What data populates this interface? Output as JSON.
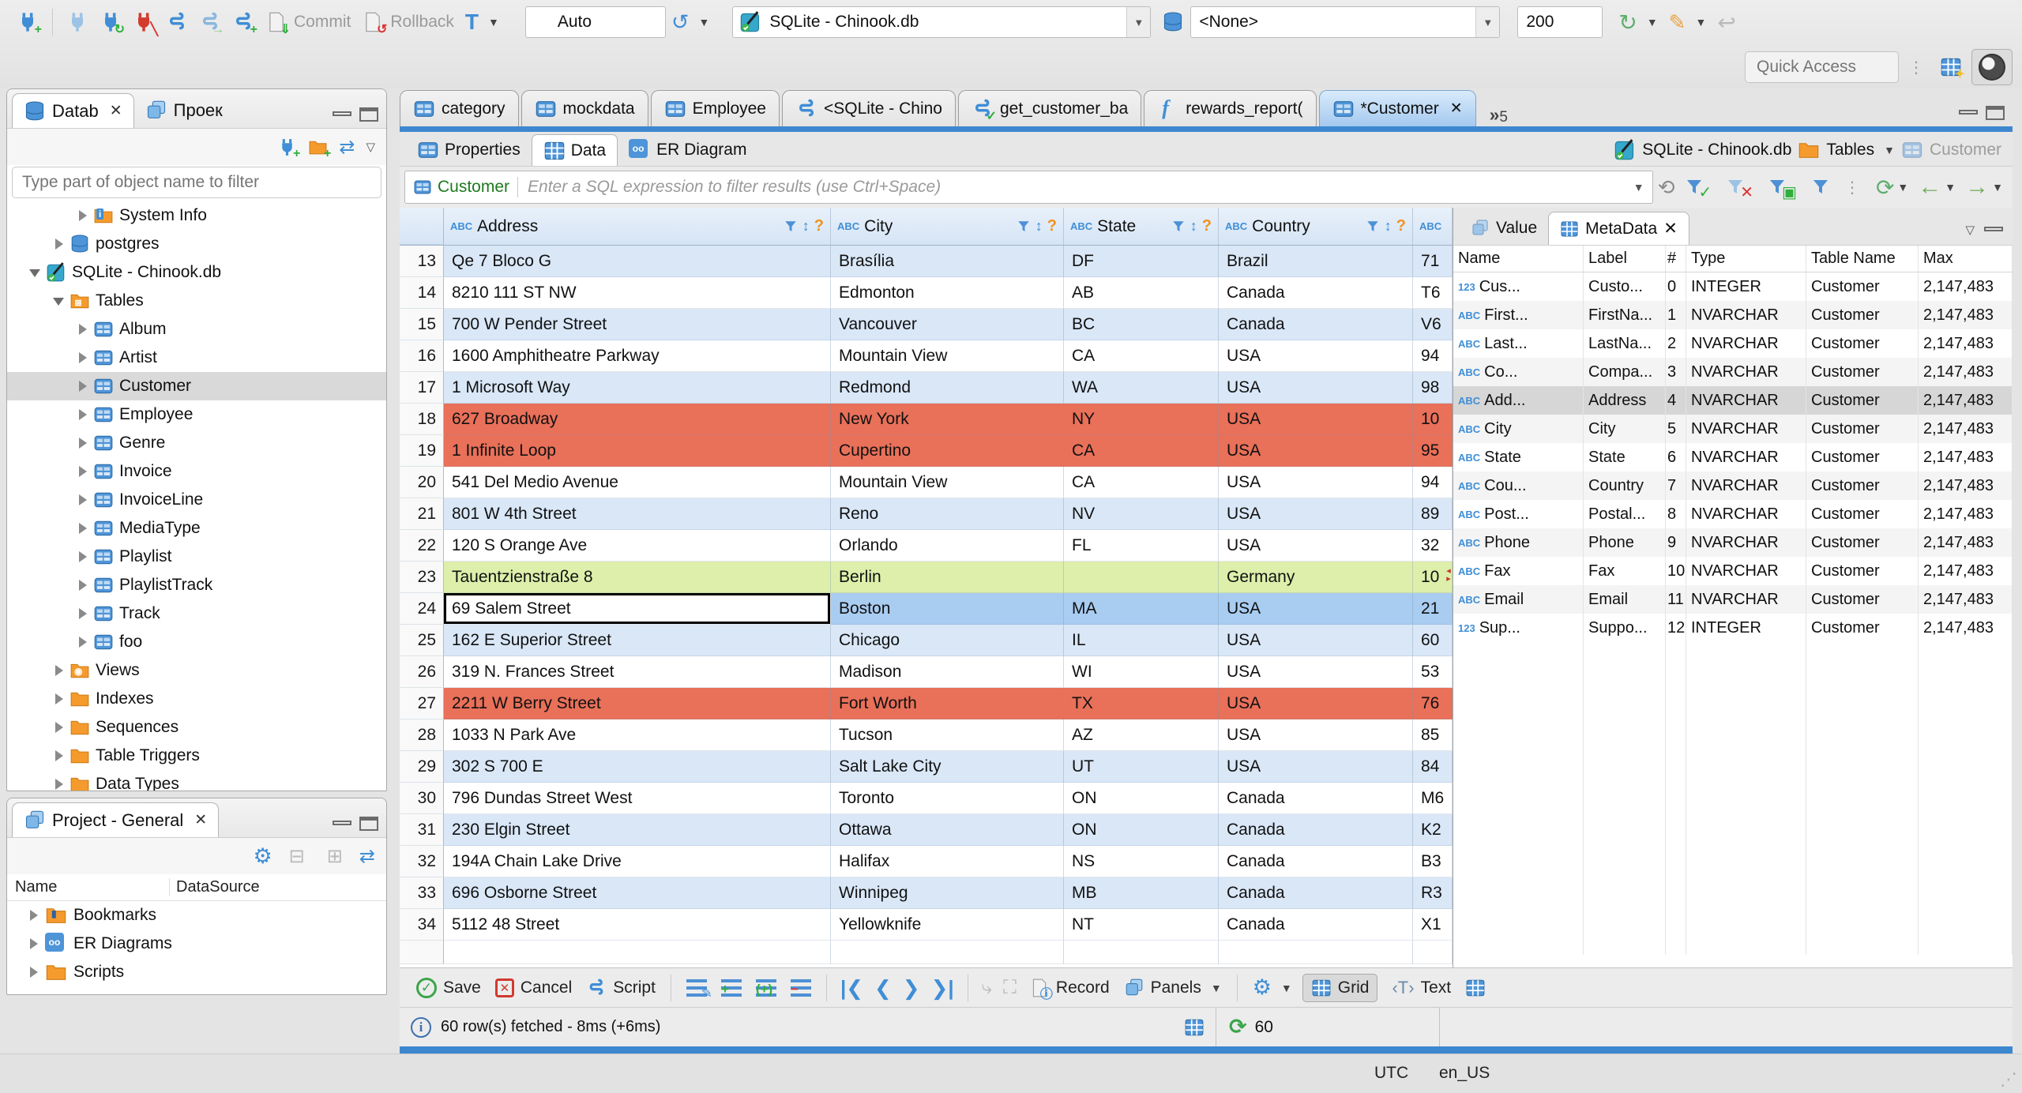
{
  "topbar": {
    "commit": "Commit",
    "rollback": "Rollback",
    "auto": "Auto",
    "connection": "SQLite - Chinook.db",
    "schema": "<None>",
    "fetch_size": "200",
    "quick_access": "Quick Access"
  },
  "nav_panel": {
    "tab_database": "Datab",
    "tab_projects": "Проек",
    "filter_placeholder": "Type part of object name to filter",
    "tree": [
      {
        "label": "System Info",
        "icon": "folder-info",
        "indent": 2,
        "arrow": "collapsed"
      },
      {
        "label": "postgres",
        "icon": "db",
        "indent": 1,
        "arrow": "collapsed"
      },
      {
        "label": "SQLite - Chinook.db",
        "icon": "sqlite",
        "indent": 0,
        "arrow": "expanded"
      },
      {
        "label": "Tables",
        "icon": "folder-table",
        "indent": 1,
        "arrow": "expanded"
      },
      {
        "label": "Album",
        "icon": "table",
        "indent": 2,
        "arrow": "collapsed"
      },
      {
        "label": "Artist",
        "icon": "table",
        "indent": 2,
        "arrow": "collapsed"
      },
      {
        "label": "Customer",
        "icon": "table",
        "indent": 2,
        "arrow": "collapsed",
        "selected": true
      },
      {
        "label": "Employee",
        "icon": "table",
        "indent": 2,
        "arrow": "collapsed"
      },
      {
        "label": "Genre",
        "icon": "table",
        "indent": 2,
        "arrow": "collapsed"
      },
      {
        "label": "Invoice",
        "icon": "table",
        "indent": 2,
        "arrow": "collapsed"
      },
      {
        "label": "InvoiceLine",
        "icon": "table",
        "indent": 2,
        "arrow": "collapsed"
      },
      {
        "label": "MediaType",
        "icon": "table",
        "indent": 2,
        "arrow": "collapsed"
      },
      {
        "label": "Playlist",
        "icon": "table",
        "indent": 2,
        "arrow": "collapsed"
      },
      {
        "label": "PlaylistTrack",
        "icon": "table",
        "indent": 2,
        "arrow": "collapsed"
      },
      {
        "label": "Track",
        "icon": "table",
        "indent": 2,
        "arrow": "collapsed"
      },
      {
        "label": "foo",
        "icon": "table",
        "indent": 2,
        "arrow": "collapsed"
      },
      {
        "label": "Views",
        "icon": "folder-eye",
        "indent": 1,
        "arrow": "collapsed"
      },
      {
        "label": "Indexes",
        "icon": "folder",
        "indent": 1,
        "arrow": "collapsed"
      },
      {
        "label": "Sequences",
        "icon": "folder",
        "indent": 1,
        "arrow": "collapsed"
      },
      {
        "label": "Table Triggers",
        "icon": "folder",
        "indent": 1,
        "arrow": "collapsed"
      },
      {
        "label": "Data Types",
        "icon": "folder",
        "indent": 1,
        "arrow": "collapsed"
      }
    ]
  },
  "project_panel": {
    "title": "Project - General",
    "columns": [
      "Name",
      "DataSource"
    ],
    "items": [
      {
        "label": "Bookmarks",
        "icon": "folder-bookmark"
      },
      {
        "label": "ER Diagrams",
        "icon": "er"
      },
      {
        "label": "Scripts",
        "icon": "folder"
      }
    ]
  },
  "editor": {
    "tabs": [
      {
        "label": "category",
        "icon": "table"
      },
      {
        "label": "mockdata",
        "icon": "table"
      },
      {
        "label": "Employee",
        "icon": "table"
      },
      {
        "label": "<SQLite - Chino",
        "icon": "script"
      },
      {
        "label": "get_customer_ba",
        "icon": "script-check"
      },
      {
        "label": "rewards_report(",
        "icon": "func"
      },
      {
        "label": "*Customer",
        "icon": "table",
        "active": true,
        "closable": true
      }
    ],
    "overflow_count": "5",
    "inner_tabs": [
      {
        "label": "Properties",
        "icon": "table"
      },
      {
        "label": "Data",
        "icon": "grid",
        "active": true
      },
      {
        "label": "ER Diagram",
        "icon": "er"
      }
    ],
    "breadcrumb": {
      "connection": "SQLite - Chinook.db",
      "container": "Tables",
      "entity": "Customer"
    }
  },
  "filter_bar": {
    "table": "Customer",
    "placeholder": "Enter a SQL expression to filter results (use Ctrl+Space)"
  },
  "grid": {
    "columns": [
      "Address",
      "City",
      "State",
      "Country"
    ],
    "partial_column": "ABC",
    "rows": [
      {
        "num": "13",
        "address": "Qe 7 Bloco G",
        "city": "Brasília",
        "state": "DF",
        "country": "Brazil",
        "postal": "71",
        "style": "tint"
      },
      {
        "num": "14",
        "address": "8210 111 ST NW",
        "city": "Edmonton",
        "state": "AB",
        "country": "Canada",
        "postal": "T6",
        "style": "plain"
      },
      {
        "num": "15",
        "address": "700 W Pender Street",
        "city": "Vancouver",
        "state": "BC",
        "country": "Canada",
        "postal": "V6",
        "style": "tint"
      },
      {
        "num": "16",
        "address": "1600 Amphitheatre Parkway",
        "city": "Mountain View",
        "state": "CA",
        "country": "USA",
        "postal": "94",
        "style": "plain"
      },
      {
        "num": "17",
        "address": "1 Microsoft Way",
        "city": "Redmond",
        "state": "WA",
        "country": "USA",
        "postal": "98",
        "style": "tint"
      },
      {
        "num": "18",
        "address": "627 Broadway",
        "city": "New York",
        "state": "NY",
        "country": "USA",
        "postal": "10",
        "style": "red"
      },
      {
        "num": "19",
        "address": "1 Infinite Loop",
        "city": "Cupertino",
        "state": "CA",
        "country": "USA",
        "postal": "95",
        "style": "red"
      },
      {
        "num": "20",
        "address": "541 Del Medio Avenue",
        "city": "Mountain View",
        "state": "CA",
        "country": "USA",
        "postal": "94",
        "style": "plain"
      },
      {
        "num": "21",
        "address": "801 W 4th Street",
        "city": "Reno",
        "state": "NV",
        "country": "USA",
        "postal": "89",
        "style": "tint"
      },
      {
        "num": "22",
        "address": "120 S Orange Ave",
        "city": "Orlando",
        "state": "FL",
        "country": "USA",
        "postal": "32",
        "style": "plain"
      },
      {
        "num": "23",
        "address": "Tauentzienstraße 8",
        "city": "Berlin",
        "state": "",
        "country": "Germany",
        "postal": "10",
        "style": "green"
      },
      {
        "num": "24",
        "address": "69 Salem Street",
        "city": "Boston",
        "state": "MA",
        "country": "USA",
        "postal": "21",
        "style": "selected"
      },
      {
        "num": "25",
        "address": "162 E Superior Street",
        "city": "Chicago",
        "state": "IL",
        "country": "USA",
        "postal": "60",
        "style": "tint"
      },
      {
        "num": "26",
        "address": "319 N. Frances Street",
        "city": "Madison",
        "state": "WI",
        "country": "USA",
        "postal": "53",
        "style": "plain"
      },
      {
        "num": "27",
        "address": "2211 W Berry Street",
        "city": "Fort Worth",
        "state": "TX",
        "country": "USA",
        "postal": "76",
        "style": "red"
      },
      {
        "num": "28",
        "address": "1033 N Park Ave",
        "city": "Tucson",
        "state": "AZ",
        "country": "USA",
        "postal": "85",
        "style": "plain"
      },
      {
        "num": "29",
        "address": "302 S 700 E",
        "city": "Salt Lake City",
        "state": "UT",
        "country": "USA",
        "postal": "84",
        "style": "tint"
      },
      {
        "num": "30",
        "address": "796 Dundas Street West",
        "city": "Toronto",
        "state": "ON",
        "country": "Canada",
        "postal": "M6",
        "style": "plain"
      },
      {
        "num": "31",
        "address": "230 Elgin Street",
        "city": "Ottawa",
        "state": "ON",
        "country": "Canada",
        "postal": "K2",
        "style": "tint"
      },
      {
        "num": "32",
        "address": "194A Chain Lake Drive",
        "city": "Halifax",
        "state": "NS",
        "country": "Canada",
        "postal": "B3",
        "style": "plain"
      },
      {
        "num": "33",
        "address": "696 Osborne Street",
        "city": "Winnipeg",
        "state": "MB",
        "country": "Canada",
        "postal": "R3",
        "style": "tint"
      },
      {
        "num": "34",
        "address": "5112 48 Street",
        "city": "Yellowknife",
        "state": "NT",
        "country": "Canada",
        "postal": "X1",
        "style": "plain"
      },
      {
        "num": "",
        "address": "",
        "city": "",
        "state": "",
        "country": "",
        "postal": "",
        "style": "plain",
        "partial": true
      }
    ]
  },
  "meta_panel": {
    "tabs": [
      "Value",
      "MetaData"
    ],
    "columns": [
      "Name",
      "Label",
      "#",
      "Type",
      "Table Name",
      "Max"
    ],
    "rows": [
      {
        "icon": "123",
        "name": "Cus...",
        "label": "Custo...",
        "num": "0",
        "type": "INTEGER",
        "table": "Customer",
        "max": "2,147,483"
      },
      {
        "icon": "abc",
        "name": "First...",
        "label": "FirstNa...",
        "num": "1",
        "type": "NVARCHAR",
        "table": "Customer",
        "max": "2,147,483"
      },
      {
        "icon": "abc",
        "name": "Last...",
        "label": "LastNa...",
        "num": "2",
        "type": "NVARCHAR",
        "table": "Customer",
        "max": "2,147,483"
      },
      {
        "icon": "abc",
        "name": "Co...",
        "label": "Compa...",
        "num": "3",
        "type": "NVARCHAR",
        "table": "Customer",
        "max": "2,147,483"
      },
      {
        "icon": "abc",
        "name": "Add...",
        "label": "Address",
        "num": "4",
        "type": "NVARCHAR",
        "table": "Customer",
        "max": "2,147,483",
        "selected": true
      },
      {
        "icon": "abc",
        "name": "City",
        "label": "City",
        "num": "5",
        "type": "NVARCHAR",
        "table": "Customer",
        "max": "2,147,483"
      },
      {
        "icon": "abc",
        "name": "State",
        "label": "State",
        "num": "6",
        "type": "NVARCHAR",
        "table": "Customer",
        "max": "2,147,483"
      },
      {
        "icon": "abc",
        "name": "Cou...",
        "label": "Country",
        "num": "7",
        "type": "NVARCHAR",
        "table": "Customer",
        "max": "2,147,483"
      },
      {
        "icon": "abc",
        "name": "Post...",
        "label": "Postal...",
        "num": "8",
        "type": "NVARCHAR",
        "table": "Customer",
        "max": "2,147,483"
      },
      {
        "icon": "abc",
        "name": "Phone",
        "label": "Phone",
        "num": "9",
        "type": "NVARCHAR",
        "table": "Customer",
        "max": "2,147,483"
      },
      {
        "icon": "abc",
        "name": "Fax",
        "label": "Fax",
        "num": "10",
        "type": "NVARCHAR",
        "table": "Customer",
        "max": "2,147,483"
      },
      {
        "icon": "abc",
        "name": "Email",
        "label": "Email",
        "num": "11",
        "type": "NVARCHAR",
        "table": "Customer",
        "max": "2,147,483"
      },
      {
        "icon": "123",
        "name": "Sup...",
        "label": "Suppo...",
        "num": "12",
        "type": "INTEGER",
        "table": "Customer",
        "max": "2,147,483"
      }
    ]
  },
  "bottom_bar": {
    "save": "Save",
    "cancel": "Cancel",
    "script": "Script",
    "record": "Record",
    "panels": "Panels",
    "grid": "Grid",
    "text": "Text",
    "status": "60 row(s) fetched - 8ms (+6ms)",
    "refresh_count": "60"
  },
  "window_status": {
    "timezone": "UTC",
    "locale": "en_US"
  },
  "colors": {
    "accent": "#3d87cf",
    "row_red": "#e97059",
    "row_new_green": "#ddefaa",
    "row_selected": "#a9ccf1",
    "row_tint": "#d9e7f7"
  }
}
